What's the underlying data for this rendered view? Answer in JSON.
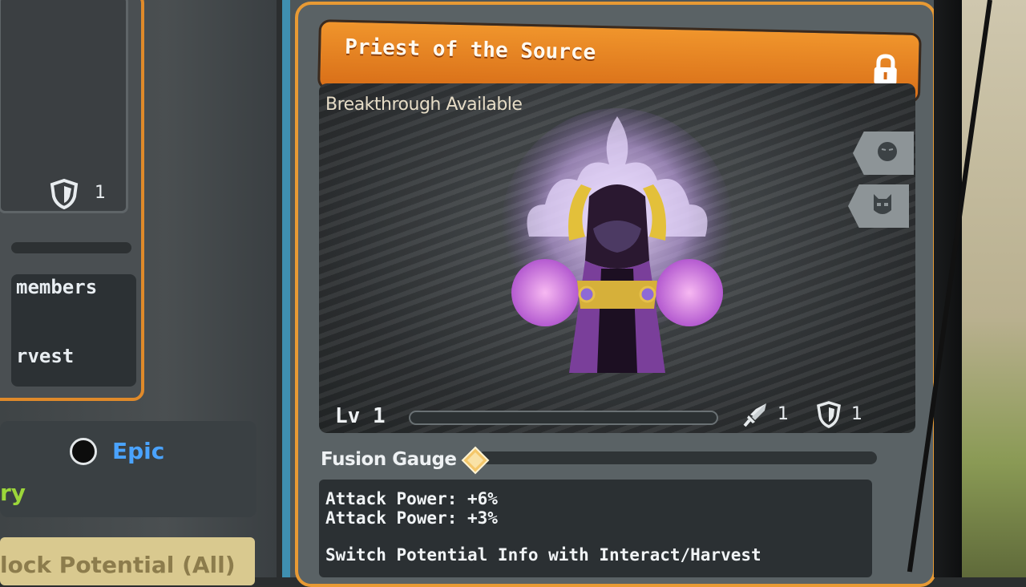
{
  "left_panel": {
    "shield_count": "1",
    "members_text": "members",
    "harvest_text": "rvest",
    "rarity_label": "Epic",
    "rarity_color": "#4aa3ff",
    "green_text": "ry",
    "potential_button_label": "lock Potential (All)"
  },
  "card": {
    "title": "Priest of the Source",
    "title_icon": "lock-icon",
    "status_text": "Breakthrough Available",
    "side_buttons": [
      "face-icon",
      "helmet-mask-icon"
    ],
    "level_label": "Lv 1",
    "xp_progress": 0.0,
    "attack_stat": "1",
    "defense_stat": "1",
    "fusion_label": "Fusion Gauge",
    "fusion_progress": 0.0,
    "info_lines": [
      "Attack Power: +6%",
      "Attack Power: +3%",
      "Switch Potential Info with Interact/Harvest"
    ],
    "accent_color": "#e89a34"
  }
}
